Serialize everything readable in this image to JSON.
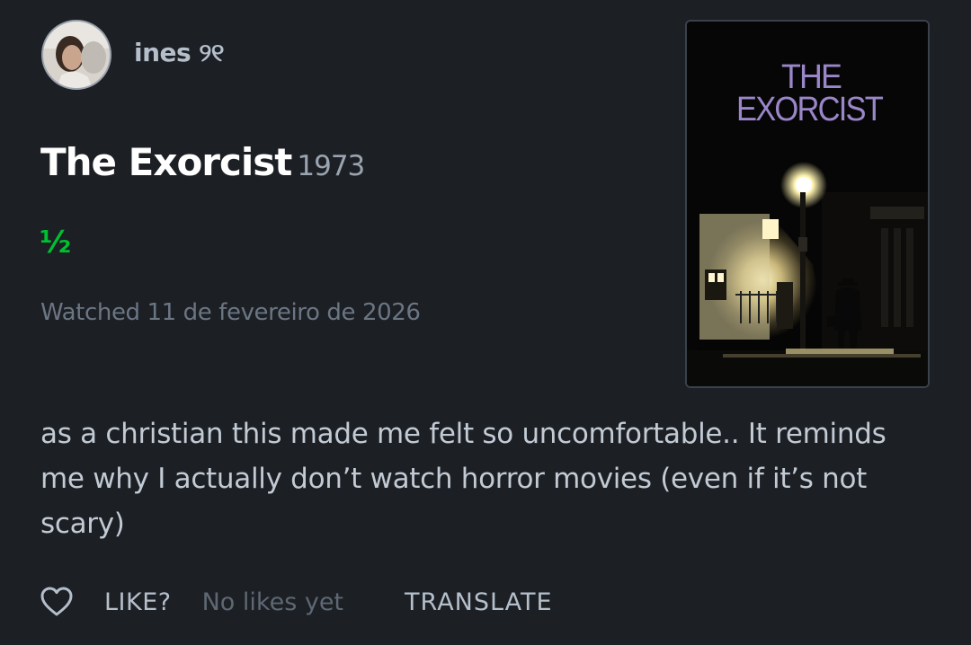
{
  "review": {
    "author": {
      "name": "ines ୨୧"
    },
    "film": {
      "title": "The Exorcist",
      "year": "1973"
    },
    "rating_text": "½",
    "rating_value": 0.5,
    "watched_text": "Watched 11 de fevereiro de 2026",
    "body": "as a christian this made me felt so uncomfortable.. It reminds me why I actually don’t watch horror movies (even if it’s not scary)"
  },
  "poster": {
    "title_line1": "THE",
    "title_line2": "EXORCIST",
    "title_color": "#9a86c8"
  },
  "actions": {
    "like_label": "LIKE?",
    "likes_count_text": "No likes yet",
    "translate_label": "TRANSLATE"
  },
  "icons": {
    "like": "heart-outline-icon"
  },
  "colors": {
    "background": "#1c1f24",
    "rating_green": "#00c030",
    "muted_text": "#6b7683"
  }
}
